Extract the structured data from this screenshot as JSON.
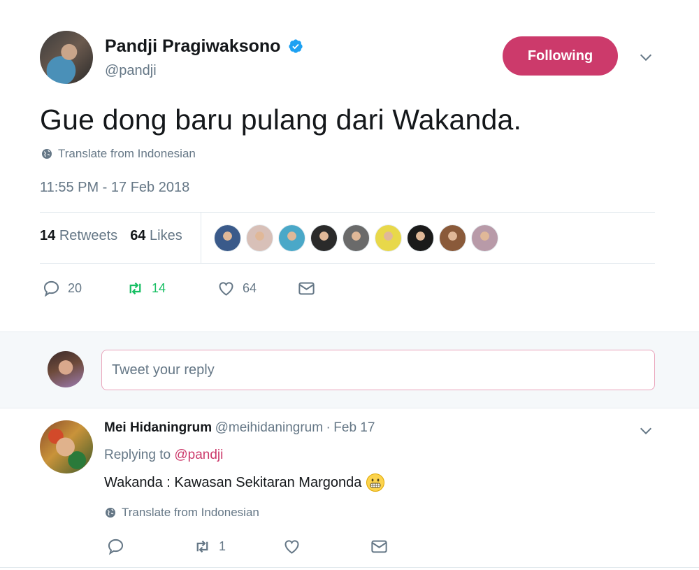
{
  "tweet": {
    "author_name": "Pandji Pragiwaksono",
    "author_handle": "@pandji",
    "follow_label": "Following",
    "text": "Gue dong baru pulang dari Wakanda.",
    "translate_label": "Translate from Indonesian",
    "timestamp": "11:55 PM - 17 Feb 2018",
    "retweets_count": "14",
    "retweets_label": "Retweets",
    "likes_count": "64",
    "likes_label": "Likes",
    "liker_colors": [
      "#3a5a8a",
      "#d8c0b8",
      "#4aa8c8",
      "#2a2a2a",
      "#6a6a6a",
      "#e8d84a",
      "#1a1a1a",
      "#8a5a3a",
      "#b89aa8"
    ],
    "actions": {
      "reply_count": "20",
      "retweet_count": "14",
      "like_count": "64"
    },
    "colors": {
      "accent": "#cc3a6b",
      "retweet": "#17bf63",
      "muted": "#657786"
    }
  },
  "composer": {
    "placeholder": "Tweet your reply"
  },
  "reply": {
    "author_name": "Mei Hidaningrum",
    "author_handle": "@meihidaningrum",
    "separator": "·",
    "date": "Feb 17",
    "replying_to_label": "Replying to",
    "replying_to_handle": "@pandji",
    "text": "Wakanda : Kawasan Sekitaran Margonda",
    "emoji": "grimacing-face",
    "translate_label": "Translate from Indonesian",
    "actions": {
      "reply_count": "",
      "retweet_count": "1",
      "like_count": ""
    }
  }
}
